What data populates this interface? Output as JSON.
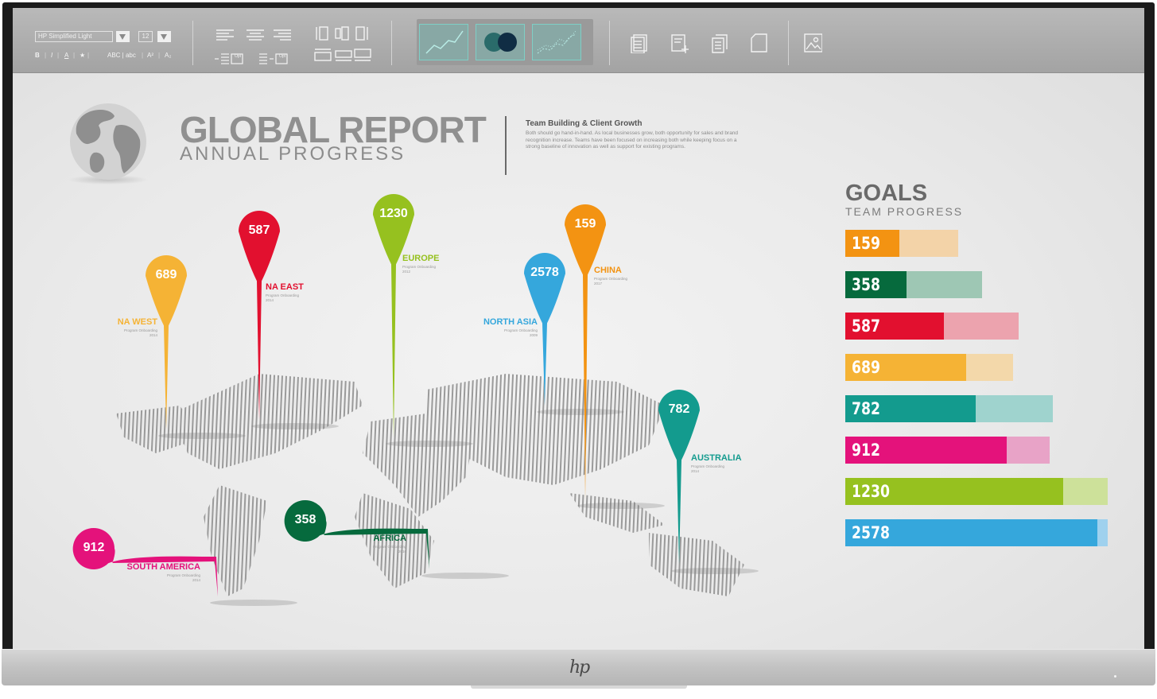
{
  "toolbar": {
    "font_name": "HP Simplified Light",
    "font_size": "12",
    "format_bold": "B",
    "format_italic": "I",
    "format_underline": "A",
    "format_highlight": "★",
    "case_upper_lower": "ABC | abc",
    "superscript": "A²",
    "subscript": "A₂",
    "opt_label": "Opt",
    "chart_buttons": [
      "line-chart-icon",
      "bubble-chart-icon",
      "scatter-chart-icon"
    ],
    "page_icons": [
      "document-list-icon",
      "document-add-icon",
      "document-stack-icon",
      "blank-page-icon",
      "image-icon"
    ]
  },
  "report": {
    "title": "GLOBAL REPORT",
    "subtitle": "ANNUAL PROGRESS",
    "blurb_title": "Team Building & Client Growth",
    "blurb_body": "Both should go hand-in-hand. As local businesses grow, both opportunity for sales and brand recognition increase. Teams have been focused on increasing both while keeping focus on a strong baseline of innovation as well as support for existing programs."
  },
  "pins": [
    {
      "id": "na-west",
      "value": "689",
      "label": "NA WEST",
      "note": "Program Onboarding",
      "year": "2014",
      "color": "#f5b335"
    },
    {
      "id": "na-east",
      "value": "587",
      "label": "NA EAST",
      "note": "Program Onboarding",
      "year": "2014",
      "color": "#e2102f"
    },
    {
      "id": "europe",
      "value": "1230",
      "label": "EUROPE",
      "note": "Program Onboarding",
      "year": "2012",
      "color": "#96c11f"
    },
    {
      "id": "north-asia",
      "value": "2578",
      "label": "NORTH ASIA",
      "note": "Program Onboarding",
      "year": "2009",
      "color": "#35a7dc"
    },
    {
      "id": "china",
      "value": "159",
      "label": "CHINA",
      "note": "Program Onboarding",
      "year": "2017",
      "color": "#f39312"
    },
    {
      "id": "australia",
      "value": "782",
      "label": "AUSTRALIA",
      "note": "Program Onboarding",
      "year": "2014",
      "color": "#139b8e"
    },
    {
      "id": "africa",
      "value": "358",
      "label": "AFRICA",
      "note": "Program Onboarding",
      "year": "2016",
      "color": "#066a3d"
    },
    {
      "id": "south-america",
      "value": "912",
      "label": "SOUTH AMERICA",
      "note": "Program Onboarding",
      "year": "2014",
      "color": "#e4127b"
    }
  ],
  "goals": {
    "title": "GOALS",
    "subtitle": "TEAM PROGRESS",
    "bars": [
      {
        "label": "159",
        "progress": 0.48,
        "target": 0.43,
        "color": "#f39312",
        "ghost": "#f3d3a8"
      },
      {
        "label": "358",
        "progress": 0.45,
        "target": 0.52,
        "color": "#066a3d",
        "ghost": "#9ec7b4"
      },
      {
        "label": "587",
        "progress": 0.57,
        "target": 0.66,
        "color": "#e2102f",
        "ghost": "#eca3ae"
      },
      {
        "label": "689",
        "progress": 0.72,
        "target": 0.64,
        "color": "#f5b335",
        "ghost": "#f3d8aa"
      },
      {
        "label": "782",
        "progress": 0.63,
        "target": 0.79,
        "color": "#139b8e",
        "ghost": "#9fd3ce"
      },
      {
        "label": "912",
        "progress": 0.79,
        "target": 0.78,
        "color": "#e4127b",
        "ghost": "#e8a3c7"
      },
      {
        "label": "1230",
        "progress": 0.83,
        "target": 1.0,
        "color": "#96c11f",
        "ghost": "#cde19a"
      },
      {
        "label": "2578",
        "progress": 0.96,
        "target": 1.0,
        "color": "#35a7dc",
        "ghost": "#9fd1ee"
      }
    ]
  },
  "brand": "hp"
}
